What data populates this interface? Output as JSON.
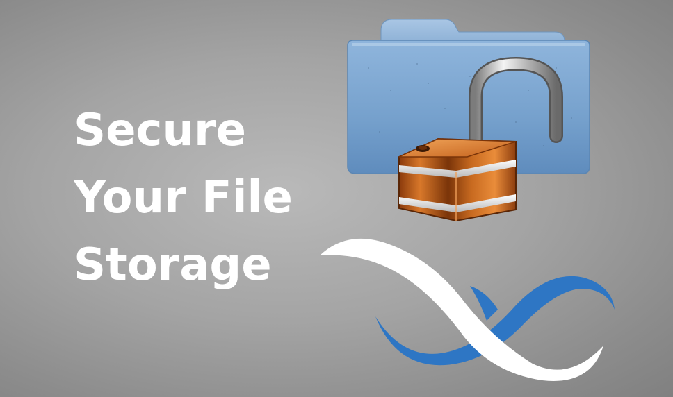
{
  "headline": {
    "line1": "Secure",
    "line2": "Your File",
    "line3": "Storage"
  },
  "colors": {
    "background": "#a8a8a8",
    "headline_text": "#ffffff",
    "folder_blue": "#7ba6d1",
    "lock_orange": "#c8631c",
    "logo_blue": "#2e76c4",
    "logo_white": "#ffffff"
  },
  "icons": [
    "folder-icon",
    "open-padlock-icon",
    "brand-logo-icon"
  ]
}
